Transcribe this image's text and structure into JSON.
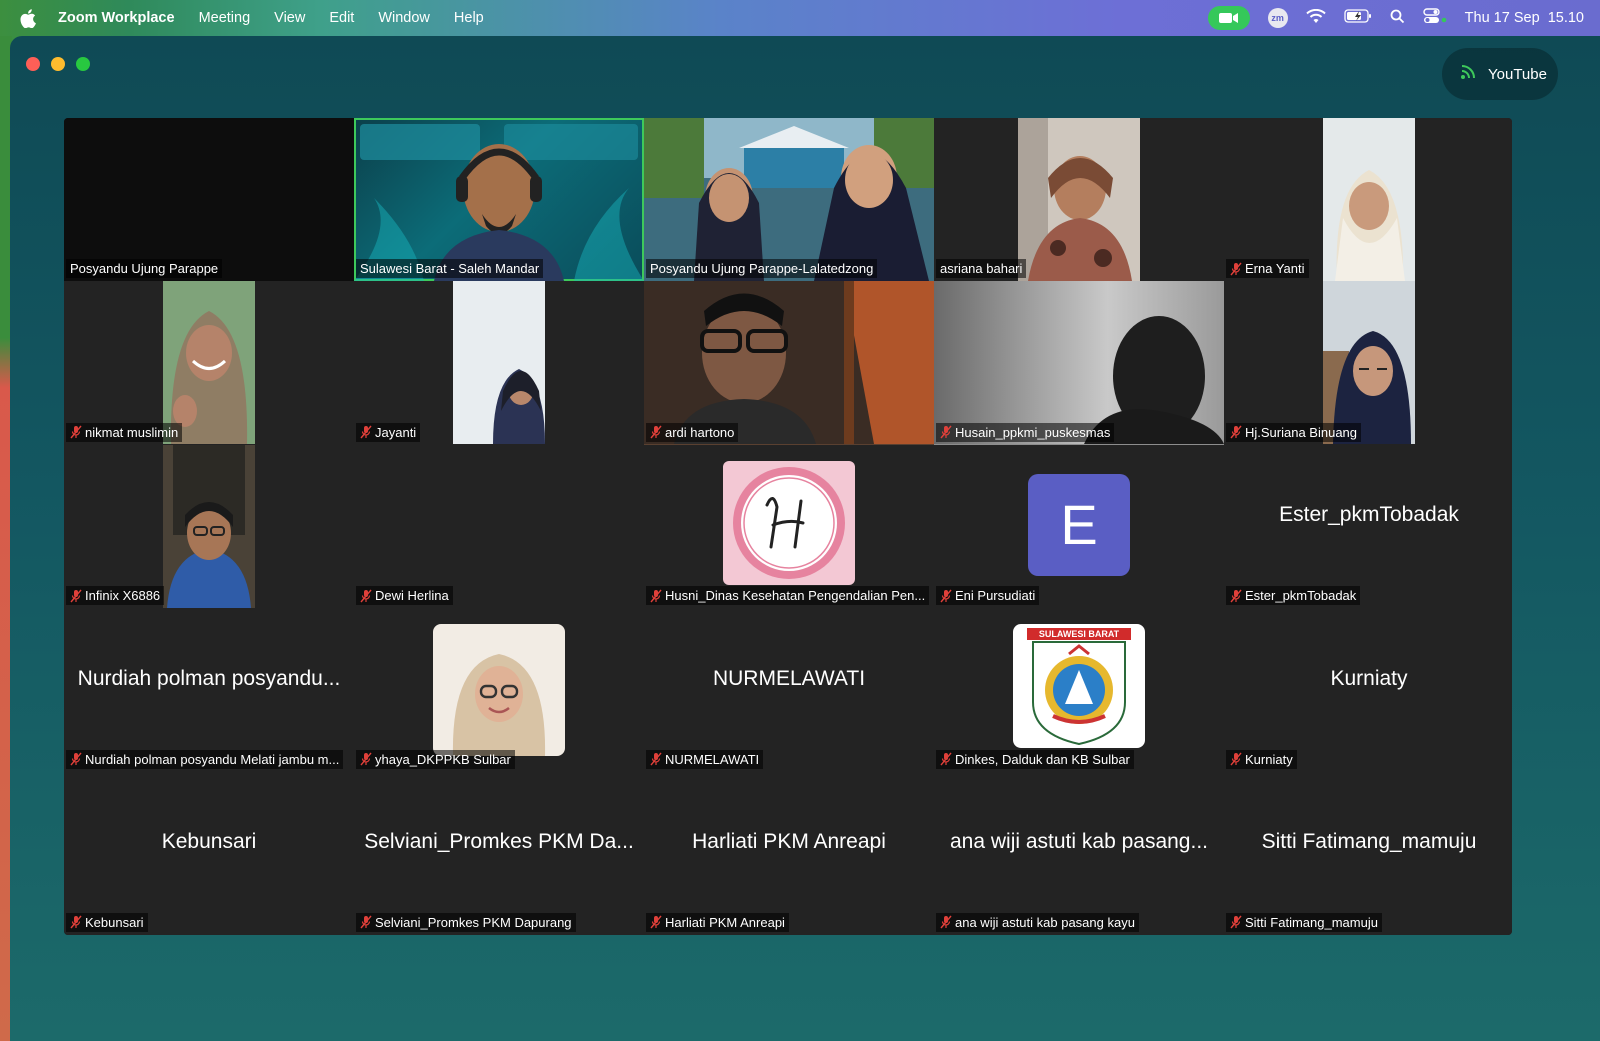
{
  "menubar": {
    "app_name": "Zoom Workplace",
    "items": [
      "Meeting",
      "View",
      "Edit",
      "Window",
      "Help"
    ],
    "clock": "Thu 17 Sep  15.10",
    "zoom_icon_text": "zm"
  },
  "window": {
    "streaming_label": "YouTube"
  },
  "participants": [
    {
      "name": "Posyandu Ujung Parappe",
      "muted": false,
      "video": "off"
    },
    {
      "name": "Sulawesi Barat - Saleh Mandar",
      "muted": false,
      "video": "on",
      "speaking": true
    },
    {
      "name": "Posyandu Ujung Parappe-Lalatedzong",
      "muted": false,
      "video": "on"
    },
    {
      "name": "asriana bahari",
      "muted": false,
      "video": "on"
    },
    {
      "name": "Erna Yanti",
      "muted": true,
      "video": "on"
    },
    {
      "name": "nikmat muslimin",
      "muted": true,
      "video": "on"
    },
    {
      "name": "Jayanti",
      "muted": true,
      "video": "on"
    },
    {
      "name": "ardi hartono",
      "muted": true,
      "video": "on"
    },
    {
      "name": "Husain_ppkmi_puskesmas",
      "muted": true,
      "video": "on"
    },
    {
      "name": "Hj.Suriana Binuang",
      "muted": true,
      "video": "on"
    },
    {
      "name": "Infinix X6886",
      "muted": true,
      "video": "on"
    },
    {
      "name": "Dewi Herlina",
      "muted": true,
      "video": "off"
    },
    {
      "name": "Husni_Dinas Kesehatan Pengendalian Pen...",
      "muted": true,
      "video": "avatar-h"
    },
    {
      "name": "Eni Pursudiati",
      "muted": true,
      "video": "avatar-e",
      "avatar_letter": "E"
    },
    {
      "name": "Ester_pkmTobadak",
      "muted": true,
      "video": "name",
      "display_name": "Ester_pkmTobadak"
    },
    {
      "name": "Nurdiah polman posyandu Melati jambu m...",
      "muted": true,
      "video": "name",
      "display_name": "Nurdiah polman posyandu..."
    },
    {
      "name": "yhaya_DKPPKB Sulbar",
      "muted": true,
      "video": "avatar-photo"
    },
    {
      "name": "NURMELAWATI",
      "muted": true,
      "video": "name",
      "display_name": "NURMELAWATI"
    },
    {
      "name": "Dinkes, Dalduk dan KB Sulbar",
      "muted": true,
      "video": "avatar-logo",
      "logo_text": "SULAWESI BARAT"
    },
    {
      "name": "Kurniaty",
      "muted": true,
      "video": "name",
      "display_name": "Kurniaty"
    },
    {
      "name": "Kebunsari",
      "muted": true,
      "video": "name",
      "display_name": "Kebunsari"
    },
    {
      "name": "Selviani_Promkes PKM Dapurang",
      "muted": true,
      "video": "name",
      "display_name": "Selviani_Promkes PKM Da..."
    },
    {
      "name": "Harliati PKM Anreapi",
      "muted": true,
      "video": "name",
      "display_name": "Harliati PKM Anreapi"
    },
    {
      "name": "ana wiji astuti kab pasang kayu",
      "muted": true,
      "video": "name",
      "display_name": "ana wiji astuti kab pasang..."
    },
    {
      "name": "Sitti Fatimang_mamuju",
      "muted": true,
      "video": "name",
      "display_name": "Sitti Fatimang_mamuju"
    }
  ],
  "colors": {
    "speaking_border": "#3ec95b",
    "mute_icon": "#e0403a",
    "tile_bg": "#232323",
    "avatar_e": "#5a5ec4"
  }
}
